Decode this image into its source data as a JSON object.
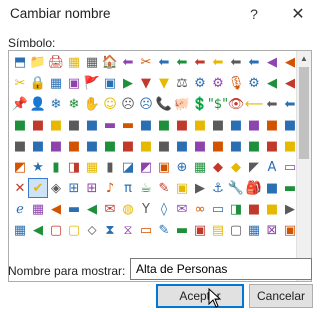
{
  "dialog": {
    "title": "Cambiar nombre",
    "help_glyph": "?",
    "close_glyph": "✕",
    "symbol_label": "Símbolo:",
    "display_name_label": "Nombre para mostrar:",
    "display_name_value": "Alta de Personas",
    "ok_label": "Aceptar",
    "cancel_label": "Cancelar"
  },
  "accent_color": "#0078d7",
  "scrollbar": {
    "up_glyph": "▲",
    "down_glyph": "▼"
  },
  "symbols": [
    [
      "⬒",
      "📁",
      "🖨",
      "▦",
      "▦",
      "🏠",
      "⬅",
      "✂",
      "⬅",
      "⬅",
      "⬅",
      "⬅",
      "⬅",
      "⬅",
      "◀",
      "◀"
    ],
    [
      "✂",
      "🔒",
      "▦",
      "▣",
      "🚩",
      "▣",
      "▶",
      "▼",
      "▼",
      "⚖",
      "⚙",
      "⚙",
      "🎙",
      "⚙",
      "◀",
      "◀"
    ],
    [
      "📌",
      "👤",
      "❄",
      "❄",
      "✋",
      "☺",
      "☹",
      "☹",
      "📞",
      "🐖",
      "💲",
      "\"$\"",
      "👁",
      "⟵",
      "⬅",
      "⬅"
    ],
    [
      "■",
      "■",
      "■",
      "■",
      "■",
      "▬",
      "▬",
      "■",
      "■",
      "■",
      "■",
      "■",
      "■",
      "■",
      "■",
      "■"
    ],
    [
      "■",
      "■",
      "■",
      "■",
      "■",
      "■",
      "■",
      "■",
      "■",
      "■",
      "■",
      "■",
      "■",
      "■",
      "■",
      "■"
    ],
    [
      "◩",
      "★",
      "▮",
      "◨",
      "▦",
      "▮",
      "◪",
      "◩",
      "▣",
      "⊕",
      "▦",
      "◆",
      "◆",
      "◤",
      "A",
      "▭"
    ],
    [
      "✕",
      "✔",
      "◈",
      "⊞",
      "⊞",
      "♪",
      "π",
      "☕",
      "✎",
      "▣",
      "▶",
      "⚓",
      "🔧",
      "🎒",
      "■",
      "▬"
    ],
    [
      "ℯ",
      "▦",
      "◀",
      "▬",
      "◀",
      "✉",
      "◍",
      "Y",
      "◊",
      "✉",
      "∞",
      "▭",
      "◨",
      "■",
      "■",
      "▶"
    ],
    [
      "▦",
      "◀",
      "▢",
      "▢",
      "⬦",
      "⧗",
      "⧖",
      "▭",
      "✎",
      "▬",
      "▣",
      "▤",
      "▢",
      "▦",
      "⊠",
      "▣"
    ],
    [
      "",
      "",
      "",
      "",
      "",
      "",
      "",
      "",
      "",
      "",
      "",
      "",
      "",
      "",
      "",
      ""
    ]
  ]
}
